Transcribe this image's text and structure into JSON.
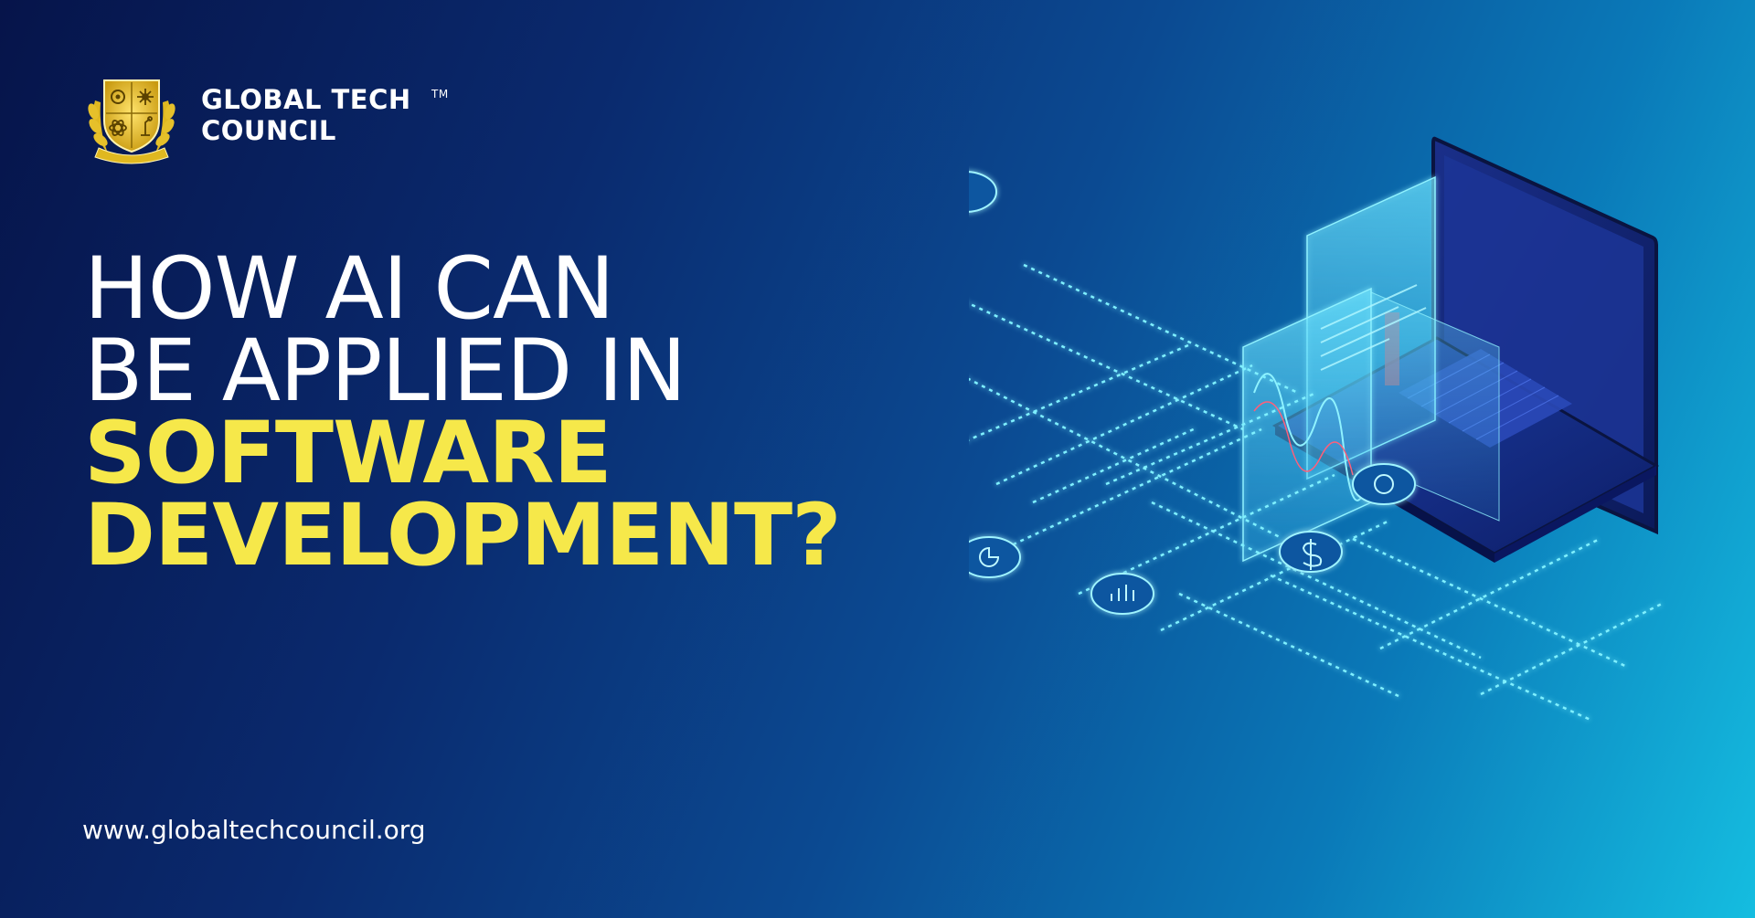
{
  "brand": {
    "name_line1": "GLOBAL TECH",
    "name_line2": "COUNCIL",
    "trademark": "TM",
    "seal_text": "Global Tech Council"
  },
  "headline": {
    "line1": "HOW AI CAN",
    "line2": "BE APPLIED IN",
    "line3": "SOFTWARE",
    "line4": "DEVELOPMENT?"
  },
  "footer": {
    "url": "www.globaltechcouncil.org"
  },
  "colors": {
    "background_dark": "#06144a",
    "background_light": "#15bde0",
    "headline_white": "#ffffff",
    "headline_yellow": "#f6e84a",
    "logo_gold": "#e0b820",
    "glow_cyan": "#5ff0ff"
  },
  "illustration": {
    "description_icons": [
      "tablet-icon",
      "briefcase-icon",
      "user-icon",
      "at-sign-icon",
      "gears-icon",
      "pie-chart-icon",
      "bar-chart-icon",
      "dollar-icon",
      "globe-icon"
    ]
  }
}
